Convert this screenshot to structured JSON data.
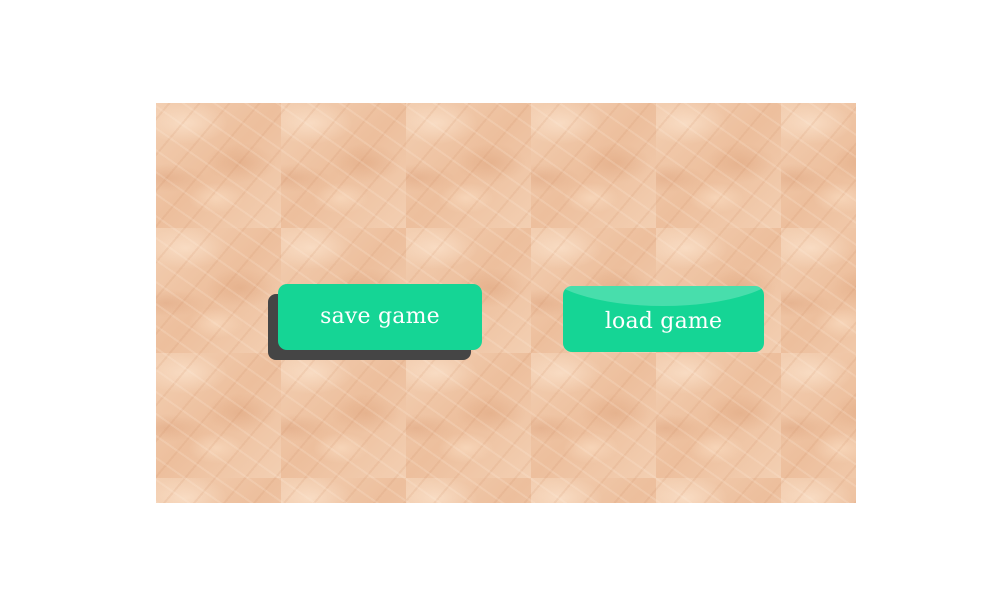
{
  "buttons": {
    "save_label": "save game",
    "load_label": "load game"
  },
  "colors": {
    "button_fill": "#15d595",
    "button_text": "#ffffff",
    "save_shadow": "#454545",
    "background_paper": "#efc6a6",
    "page_background": "#ffffff"
  },
  "background": {
    "texture": "crumpled-paper"
  }
}
